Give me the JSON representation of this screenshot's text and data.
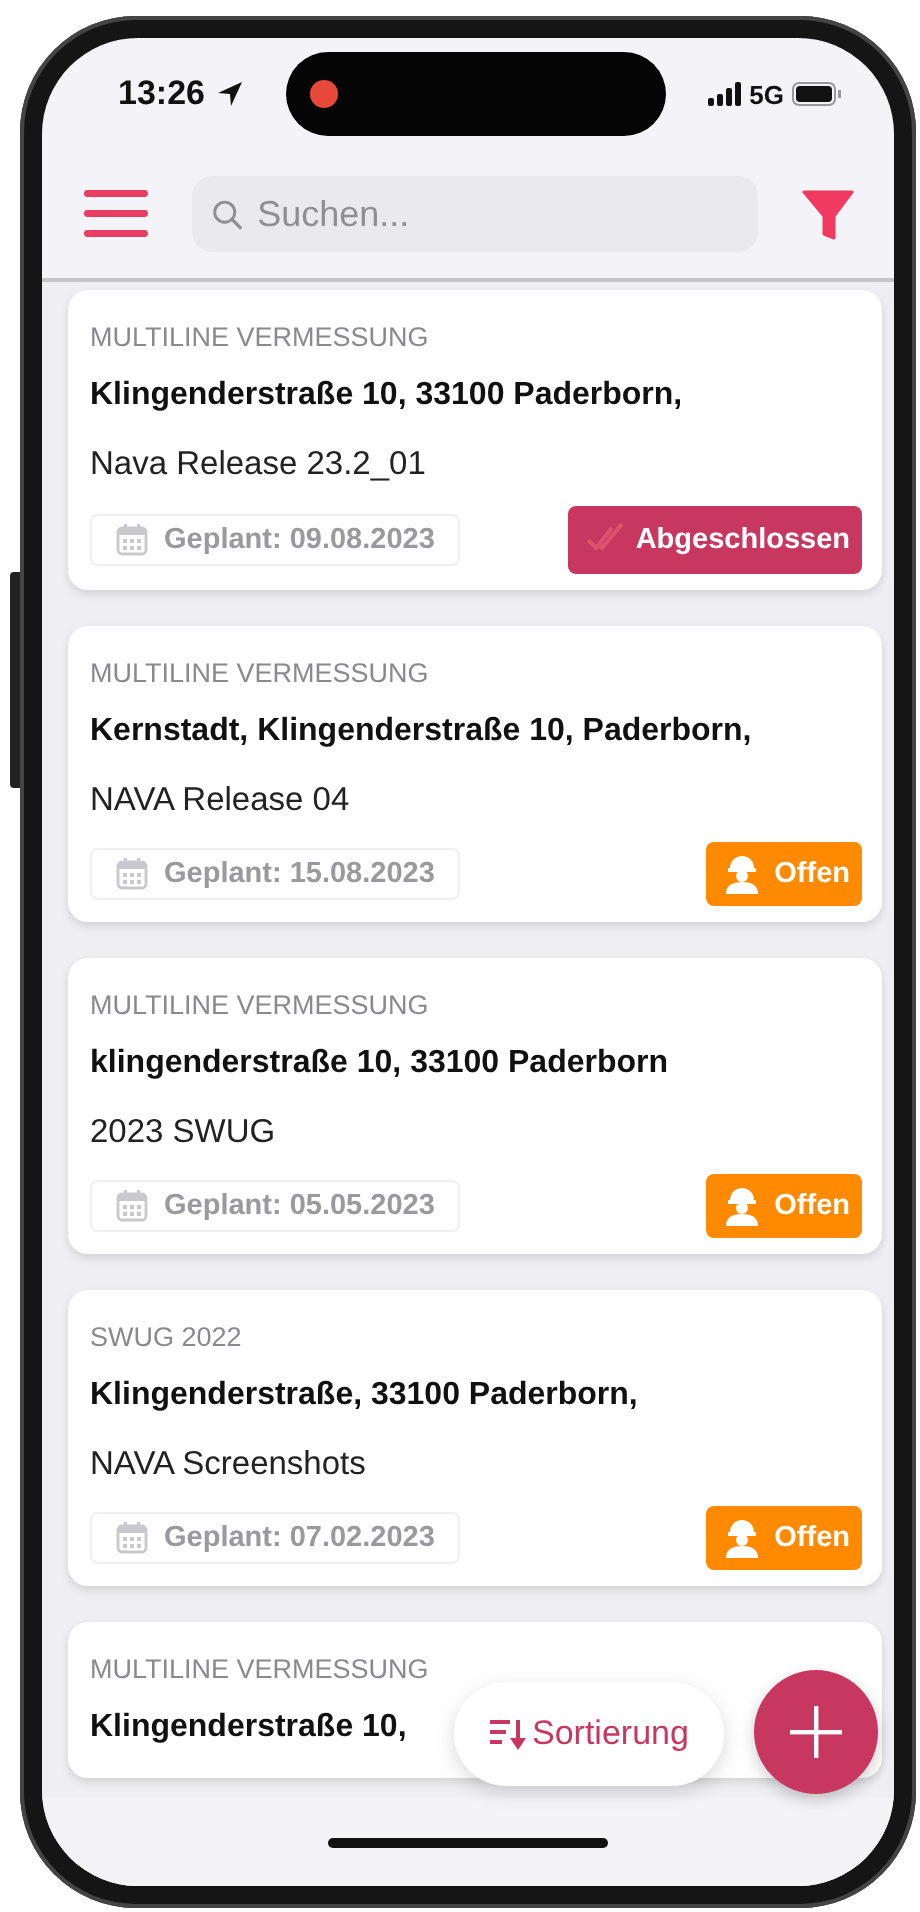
{
  "status_bar": {
    "time": "13:26",
    "network": "5G"
  },
  "toolbar": {
    "search": {
      "placeholder": "Suchen..."
    }
  },
  "cards": [
    {
      "category": "MULTILINE VERMESSUNG",
      "title": "Klingenderstraße 10, 33100 Paderborn,",
      "subtitle": "Nava Release 23.2_01",
      "planned": "Geplant: 09.08.2023",
      "status": {
        "kind": "done",
        "label": "Abgeschlossen"
      }
    },
    {
      "category": "MULTILINE VERMESSUNG",
      "title": "Kernstadt, Klingenderstraße 10, Paderborn,",
      "subtitle": "NAVA Release 04",
      "planned": "Geplant: 15.08.2023",
      "status": {
        "kind": "open",
        "label": "Offen"
      }
    },
    {
      "category": "MULTILINE VERMESSUNG",
      "title": "klingenderstraße 10, 33100 Paderborn",
      "subtitle": "2023 SWUG",
      "planned": "Geplant: 05.05.2023",
      "status": {
        "kind": "open",
        "label": "Offen"
      }
    },
    {
      "category": "SWUG 2022",
      "title": "Klingenderstraße, 33100 Paderborn,",
      "subtitle": "NAVA Screenshots",
      "planned": "Geplant: 07.02.2023",
      "status": {
        "kind": "open",
        "label": "Offen"
      }
    },
    {
      "category": "MULTILINE VERMESSUNG",
      "title": "Klingenderstraße 10,"
    }
  ],
  "sort_button": {
    "label": "Sortierung"
  }
}
